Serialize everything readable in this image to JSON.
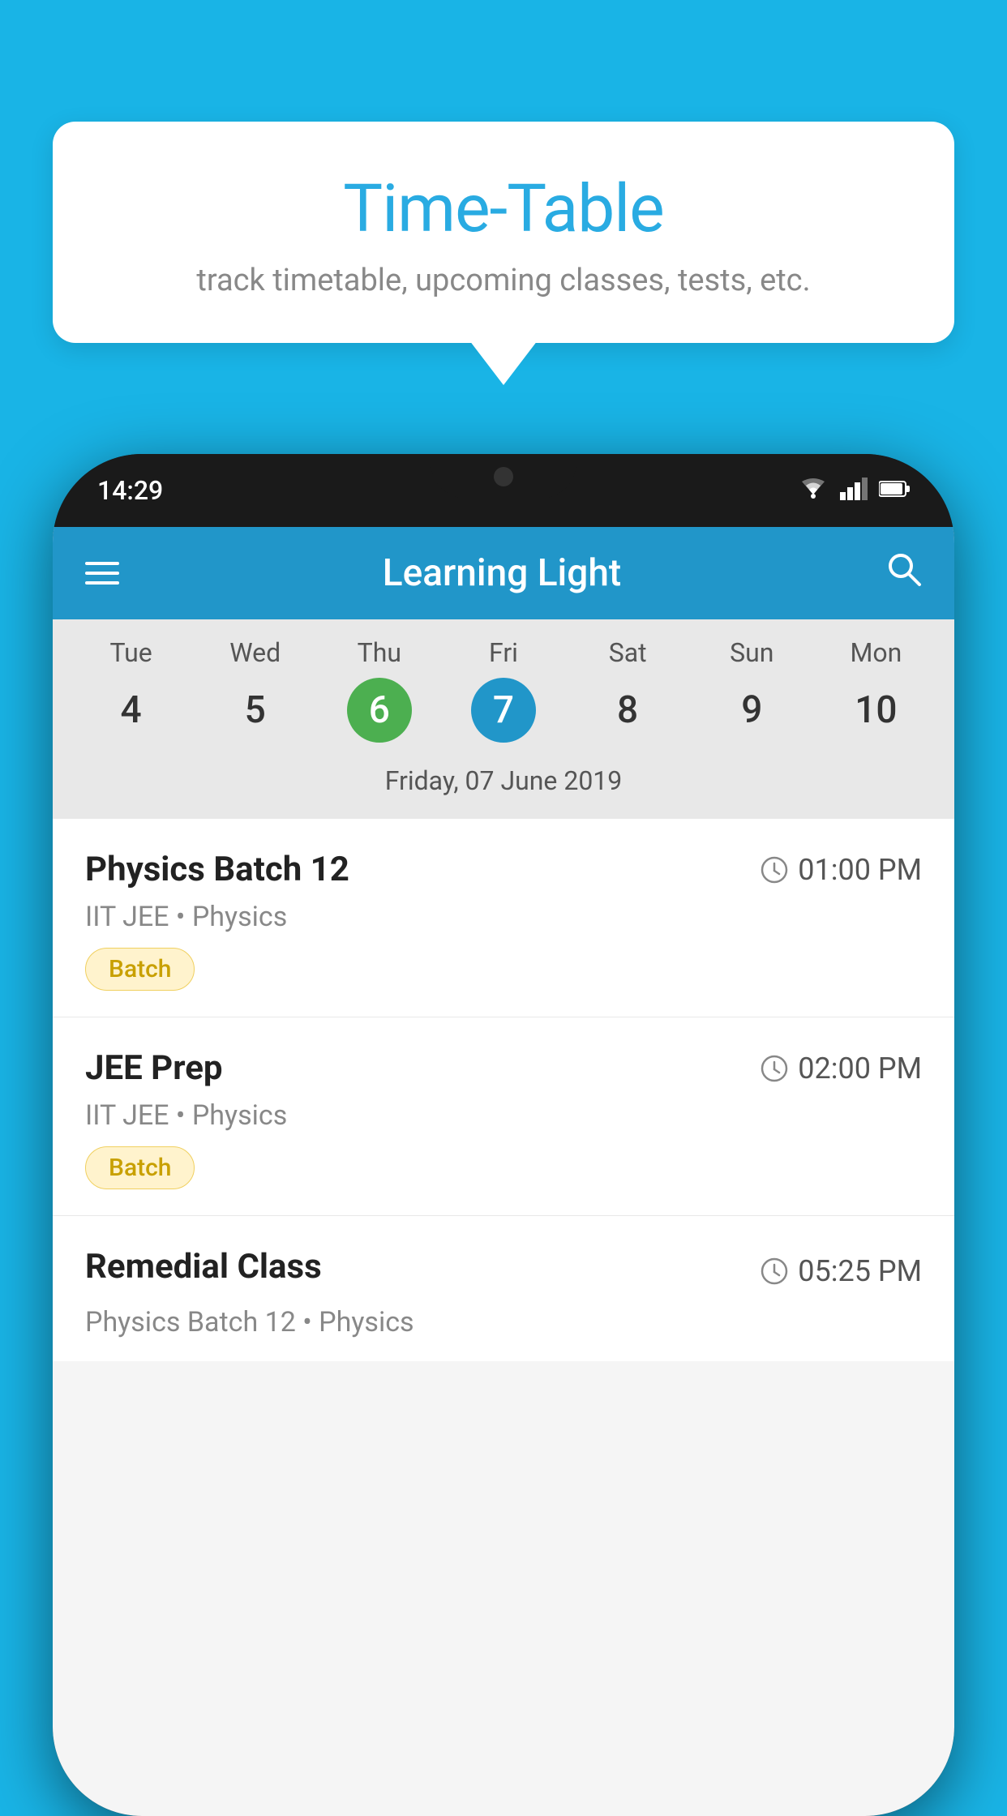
{
  "background_color": "#19b4e6",
  "speech_bubble": {
    "title": "Time-Table",
    "subtitle": "track timetable, upcoming classes, tests, etc."
  },
  "phone": {
    "status_bar": {
      "time": "14:29",
      "wifi": "▾",
      "signal": "▴",
      "battery": "▮"
    },
    "app_header": {
      "title": "Learning Light",
      "menu_icon": "menu",
      "search_icon": "search"
    },
    "calendar": {
      "days": [
        {
          "name": "Tue",
          "number": "4",
          "state": "normal"
        },
        {
          "name": "Wed",
          "number": "5",
          "state": "normal"
        },
        {
          "name": "Thu",
          "number": "6",
          "state": "today"
        },
        {
          "name": "Fri",
          "number": "7",
          "state": "selected"
        },
        {
          "name": "Sat",
          "number": "8",
          "state": "normal"
        },
        {
          "name": "Sun",
          "number": "9",
          "state": "normal"
        },
        {
          "name": "Mon",
          "number": "10",
          "state": "normal"
        }
      ],
      "selected_date_label": "Friday, 07 June 2019"
    },
    "classes": [
      {
        "name": "Physics Batch 12",
        "time": "01:00 PM",
        "subtitle": "IIT JEE • Physics",
        "tag": "Batch"
      },
      {
        "name": "JEE Prep",
        "time": "02:00 PM",
        "subtitle": "IIT JEE • Physics",
        "tag": "Batch"
      },
      {
        "name": "Remedial Class",
        "time": "05:25 PM",
        "subtitle": "Physics Batch 12 • Physics",
        "tag": null,
        "partial": true
      }
    ]
  }
}
